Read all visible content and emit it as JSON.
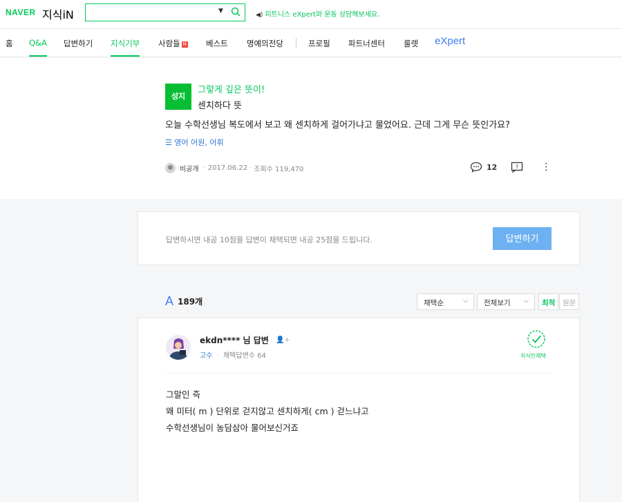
{
  "header": {
    "brand": "NAVER",
    "service": "지식iN",
    "search": {
      "value": "",
      "placeholder": ""
    },
    "promo": "피트니스 eXpert와 운동 상담해보세요."
  },
  "nav": {
    "items": [
      "홈",
      "Q&A",
      "답변하기",
      "지식기부",
      "사람들",
      "베스트",
      "명예의전당",
      "프로필",
      "파트너센터",
      "룰렛"
    ],
    "new_badge": "N",
    "expert": "eXpert"
  },
  "question": {
    "badge": "성지",
    "subtitle": "그렇게 깊은 뜻이!",
    "title": "센치하다 뜻",
    "body": "오늘 수학선생님 복도에서 보고 왜 센치하게 걸어가냐고 물었어요. 근데 그게 무슨 뜻인가요?",
    "category": "영어 어원, 어휘",
    "author": "비공개",
    "date": "2017.06.22",
    "views": "조회수 119,470",
    "comments": "12"
  },
  "answer_prompt": {
    "text": "답변하시면 내공 10점을 답변이 채택되면 내공 25점을 드립니다.",
    "button": "답변하기"
  },
  "answers": {
    "count": "189개",
    "sort_select": "채택순",
    "filter_select": "전체보기",
    "tab_latest": "최적",
    "tab_original": "원문"
  },
  "answer": {
    "name": "ekdn**** 님 답변",
    "rank": "고수",
    "adopted": "채택답변수 64",
    "adopt_label": "지식인채택",
    "lines": [
      "그말인 즉",
      "왜 미터( m ) 단위로 걷지않고 센치하게( cm ) 걷느냐고",
      "수학선생님이 농담삼아 물어보신거죠"
    ]
  },
  "colors": {
    "brand": "#03c75a",
    "expert": "#3f7cf2",
    "answer_button": "#6db1f2"
  }
}
